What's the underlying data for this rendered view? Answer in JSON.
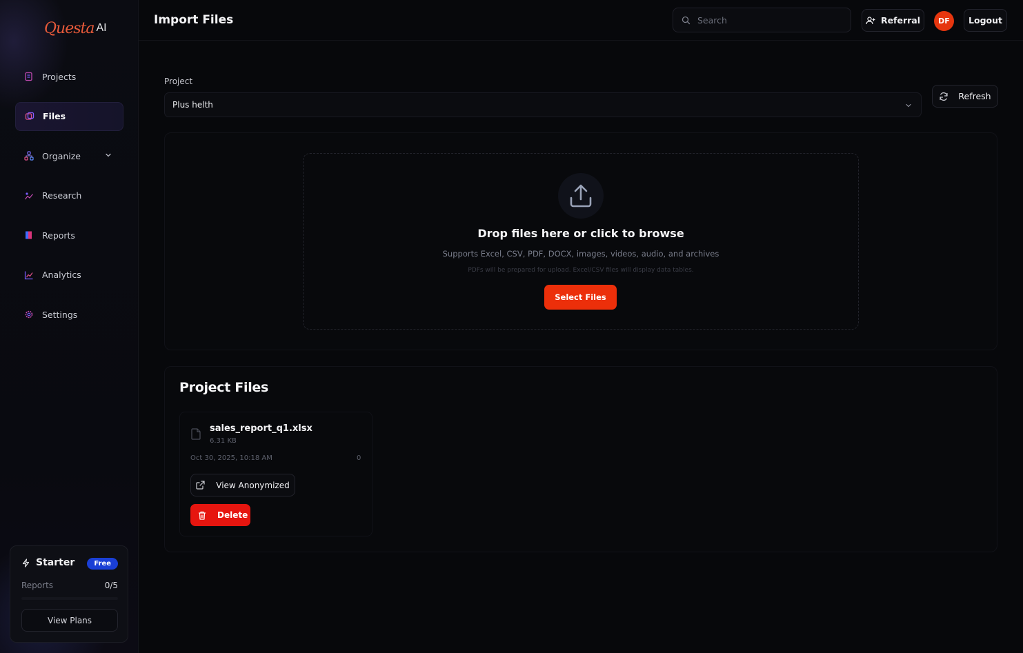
{
  "app": {
    "logo_script": "Questa",
    "logo_ai": "AI"
  },
  "sidebar": {
    "items": [
      {
        "label": "Projects",
        "icon": "projects-icon"
      },
      {
        "label": "Files",
        "icon": "files-icon",
        "active": true
      },
      {
        "label": "Organize",
        "icon": "organize-icon",
        "expandable": true
      },
      {
        "label": "Research",
        "icon": "research-icon"
      },
      {
        "label": "Reports",
        "icon": "reports-icon"
      },
      {
        "label": "Analytics",
        "icon": "analytics-icon"
      },
      {
        "label": "Settings",
        "icon": "settings-icon"
      }
    ],
    "plan": {
      "name": "Starter",
      "badge": "Free",
      "usage_label": "Reports",
      "usage_count": "0/5",
      "usage_fraction": 0,
      "button": "View Plans"
    }
  },
  "header": {
    "title": "Import Files",
    "search_placeholder": "Search",
    "referral": "Referral",
    "avatar_initials": "DF",
    "logout": "Logout"
  },
  "project_select": {
    "label": "Project",
    "value": "Plus helth",
    "refresh": "Refresh"
  },
  "upload": {
    "title": "Drop files here or click to browse",
    "subtitle": "Supports Excel, CSV, PDF, DOCX, images, videos, audio, and archives",
    "note": "PDFs will be prepared for upload. Excel/CSV files will display data tables.",
    "button": "Select Files"
  },
  "project_files": {
    "title": "Project Files",
    "files": [
      {
        "name": "sales_report_q1.xlsx",
        "size": "6.31 KB",
        "date": "Oct 30, 2025, 10:18 AM",
        "count": "0",
        "view_button": "View Anonymized",
        "delete_button": "Delete"
      }
    ]
  },
  "colors": {
    "accent": "#ec2f0a",
    "danger": "#e6150f",
    "badge": "#1a3fd6",
    "background": "#07080b"
  }
}
